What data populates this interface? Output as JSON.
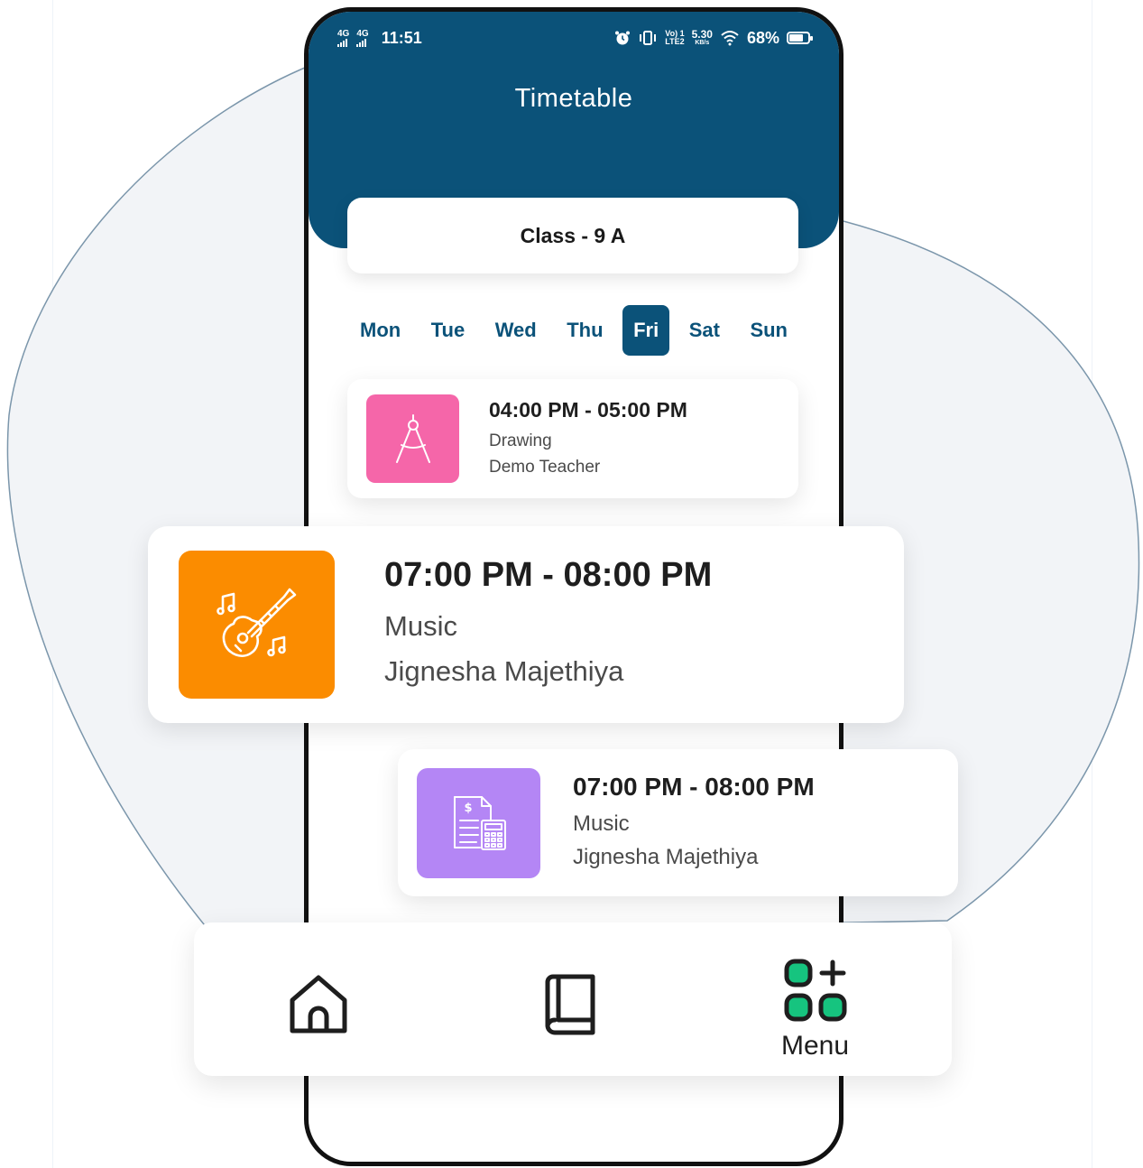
{
  "status_bar": {
    "network_1": "4G",
    "network_2": "4G",
    "time": "11:51",
    "volte_top": "Vo) 1",
    "volte_bottom": "LTE2",
    "speed_value": "5.30",
    "speed_unit": "KB/s",
    "battery": "68%",
    "battery_level": 0.68
  },
  "header": {
    "title": "Timetable"
  },
  "class_selector": {
    "label": "Class - 9 A"
  },
  "days": [
    {
      "label": "Mon",
      "active": false
    },
    {
      "label": "Tue",
      "active": false
    },
    {
      "label": "Wed",
      "active": false
    },
    {
      "label": "Thu",
      "active": false
    },
    {
      "label": "Fri",
      "active": true
    },
    {
      "label": "Sat",
      "active": false
    },
    {
      "label": "Sun",
      "active": false
    }
  ],
  "slots": [
    {
      "time": "04:00 PM - 05:00 PM",
      "subject": "Drawing",
      "teacher": "Demo Teacher",
      "icon": "compass-icon",
      "color": "#f566a9"
    },
    {
      "time": "07:00 PM - 08:00 PM",
      "subject": "Music",
      "teacher": "Jignesha Majethiya",
      "icon": "guitar-icon",
      "color": "#fb8c00"
    },
    {
      "time": "07:00 PM - 08:00 PM",
      "subject": "Music",
      "teacher": "Jignesha Majethiya",
      "icon": "invoice-calculator-icon",
      "color": "#b486f5"
    }
  ],
  "bottom_nav": {
    "items": [
      {
        "icon": "home-icon",
        "label": ""
      },
      {
        "icon": "book-icon",
        "label": ""
      },
      {
        "icon": "menu-grid-plus-icon",
        "label": "Menu"
      }
    ],
    "accent": "#16c47f"
  },
  "theme": {
    "primary": "#0b5279"
  }
}
